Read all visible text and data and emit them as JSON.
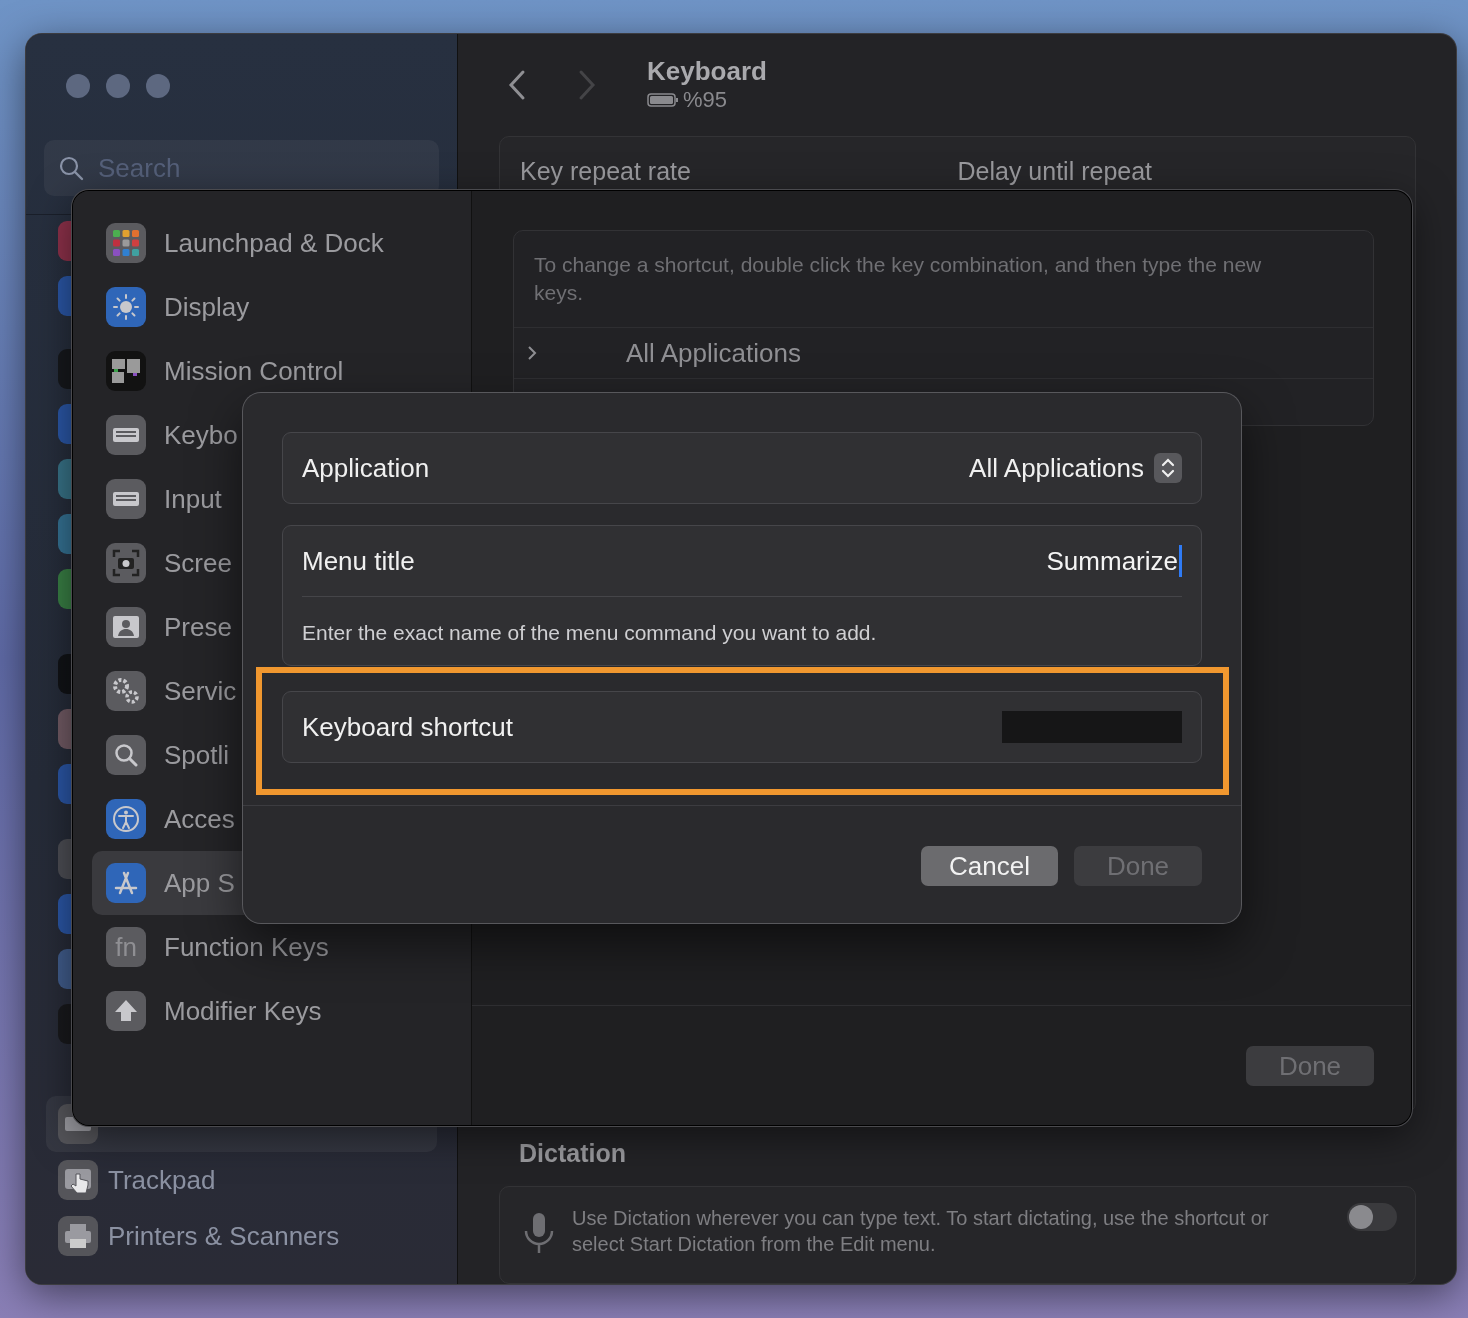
{
  "sidebar": {
    "search": {
      "placeholder": "Search"
    },
    "items": [
      {
        "selected": true
      },
      {
        "label": "Trackpad",
        "selected": false
      },
      {
        "label": "Printers & Scanners",
        "selected": false
      }
    ]
  },
  "header": {
    "title": "Keyboard",
    "battery": "%95"
  },
  "key_repeat": {
    "labels": [
      "Key repeat rate",
      "Delay until repeat"
    ]
  },
  "dictation": {
    "title": "Dictation",
    "description": "Use Dictation wherever you can type text. To start dictating, use the shortcut or select Start Dictation from the Edit menu.",
    "on": false
  },
  "shortcuts_sheet": {
    "sidebar": [
      {
        "label": "Launchpad & Dock",
        "selected": false
      },
      {
        "label": "Display",
        "selected": false
      },
      {
        "label": "Mission Control",
        "selected": false
      },
      {
        "label": "Keybo",
        "selected": false
      },
      {
        "label": "Input",
        "selected": false
      },
      {
        "label": "Scree",
        "selected": false
      },
      {
        "label": "Prese",
        "selected": false
      },
      {
        "label": "Servic",
        "selected": false
      },
      {
        "label": "Spotli",
        "selected": false
      },
      {
        "label": "Acces",
        "selected": false
      },
      {
        "label": "App S",
        "selected": true
      },
      {
        "label": "Function Keys",
        "selected": false,
        "icon_text": "fn"
      },
      {
        "label": "Modifier Keys",
        "selected": false
      }
    ],
    "hint": "To change a shortcut, double click the key combination, and then type the new keys.",
    "rows": [
      {
        "label": "All Applications",
        "expanded": false
      }
    ],
    "done": {
      "label": "Done",
      "disabled": true
    }
  },
  "dialog": {
    "application": {
      "label": "Application",
      "value": "All Applications"
    },
    "menu_title": {
      "label": "Menu title",
      "value": "Summarize",
      "hint": "Enter the exact name of the menu command you want to add."
    },
    "shortcut": {
      "label": "Keyboard shortcut",
      "highlighted": true
    },
    "buttons": [
      {
        "label": "Cancel",
        "disabled": false
      },
      {
        "label": "Done",
        "disabled": true
      }
    ]
  }
}
